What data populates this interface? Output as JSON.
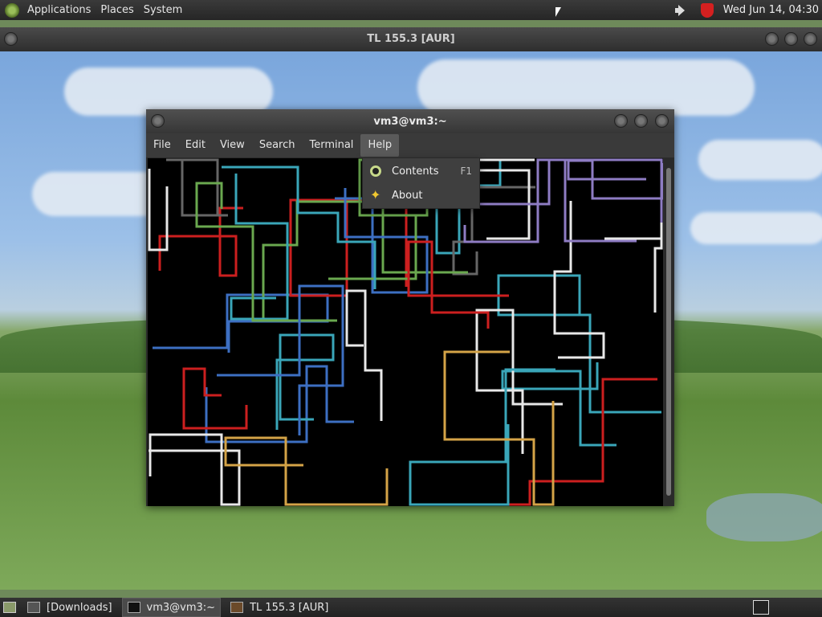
{
  "top_panel": {
    "menus": [
      "Applications",
      "Places",
      "System"
    ],
    "clock": "Wed Jun 14, 04:30"
  },
  "background_window": {
    "title": "TL 155.3 [AUR]"
  },
  "terminal": {
    "title": "vm3@vm3:~",
    "menu": [
      "File",
      "Edit",
      "View",
      "Search",
      "Terminal",
      "Help"
    ],
    "active_menu": "Help"
  },
  "help_menu": {
    "items": [
      {
        "label": "Contents",
        "accel": "F1",
        "icon": "help-icon"
      },
      {
        "label": "About",
        "accel": "",
        "icon": "star-icon"
      }
    ]
  },
  "taskbar": {
    "tasks": [
      {
        "label": "[Downloads]",
        "icon": "folder-icon"
      },
      {
        "label": "vm3@vm3:~",
        "icon": "terminal-icon"
      },
      {
        "label": "TL 155.3 [AUR]",
        "icon": "minecraft-icon"
      }
    ]
  },
  "colors": {
    "pipe_green": "#6aa84f",
    "pipe_white": "#e8e8e8",
    "pipe_purple": "#8e7cc3",
    "pipe_orange": "#d4a347",
    "pipe_cyan": "#3aa6b9",
    "pipe_red": "#cc1f1f",
    "pipe_blue": "#3d6fc2",
    "pipe_gray": "#666666"
  }
}
